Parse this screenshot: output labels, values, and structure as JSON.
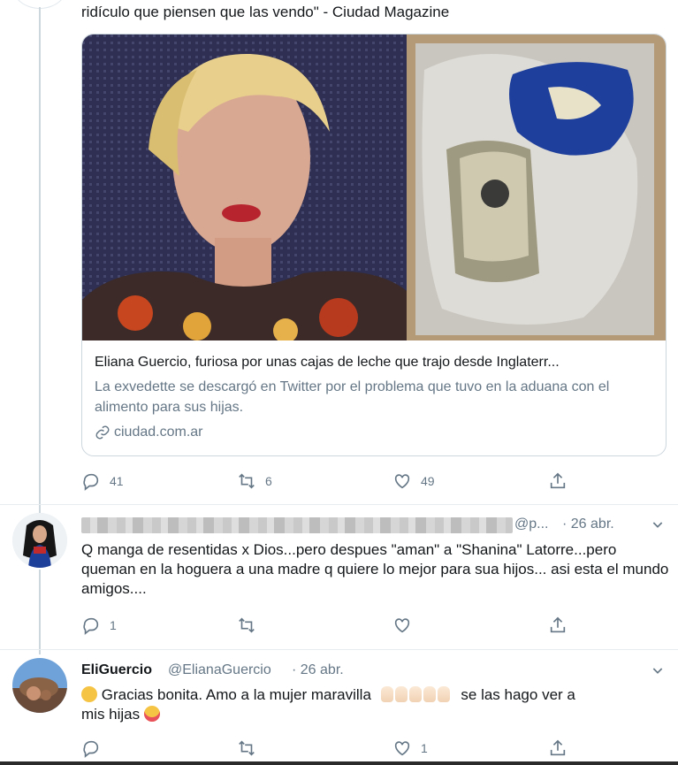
{
  "tweet1": {
    "text_fragment": "ridículo que piensen que las vendo\" - Ciudad Magazine",
    "card": {
      "title": "Eliana Guercio, furiosa por unas cajas de leche que trajo desde Inglaterr...",
      "description": "La exvedette se descargó en Twitter por el problema que tuvo en la aduana con el alimento para sus hijas.",
      "domain": "ciudad.com.ar"
    },
    "actions": {
      "replies": "41",
      "retweets": "6",
      "likes": "49"
    }
  },
  "reply1": {
    "handle": "@p...",
    "date": "· 26 abr.",
    "text": "Q manga de resentidas x Dios...pero despues \"aman\" a \"Shanina\" Latorre...pero queman en la hoguera a una madre q quiere lo mejor para sua hijos... asi esta el mundo amigos....",
    "actions": {
      "replies": "1",
      "retweets": "",
      "likes": ""
    }
  },
  "reply2": {
    "name": "EliGuercio",
    "handle": "@ElianaGuercio",
    "date": "· 26 abr.",
    "text_a": "Gracias bonita. Amo a la mujer maravilla",
    "text_b": "se las hago ver a",
    "text_c": "mis hijas",
    "actions": {
      "replies": "",
      "retweets": "",
      "likes": "1"
    }
  },
  "icons": [
    "reply-icon",
    "retweet-icon",
    "like-icon",
    "share-icon",
    "link-icon",
    "chevron-down-icon"
  ],
  "colors": {
    "secondary_text": "#657786",
    "border": "#ccd6dd",
    "text": "#14171a"
  }
}
